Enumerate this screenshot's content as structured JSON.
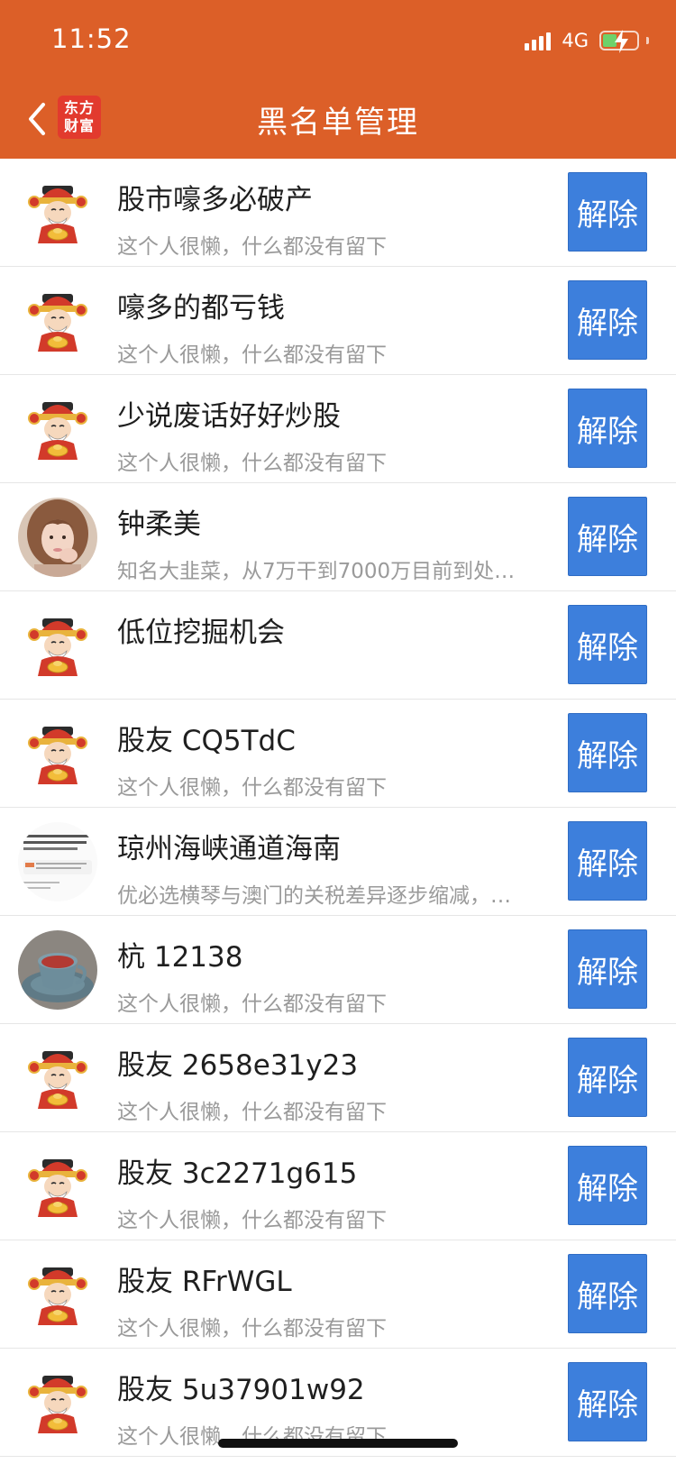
{
  "status_bar": {
    "time": "11:52",
    "network": "4G"
  },
  "header": {
    "title": "黑名单管理",
    "logo_line1": "东方",
    "logo_line2": "财富"
  },
  "colors": {
    "accent": "#dc5f28",
    "button": "#3d7fdc"
  },
  "items": [
    {
      "name": "股市嚎多必破产",
      "signature": "这个人很懒，什么都没有留下",
      "button": "解除",
      "avatar": "default-mascot"
    },
    {
      "name": "嚎多的都亏钱",
      "signature": "这个人很懒，什么都没有留下",
      "button": "解除",
      "avatar": "default-mascot"
    },
    {
      "name": "少说废话好好炒股",
      "signature": "这个人很懒，什么都没有留下",
      "button": "解除",
      "avatar": "default-mascot"
    },
    {
      "name": "钟柔美",
      "signature": "知名大韭菜，从7万干到7000万目前到处…",
      "button": "解除",
      "avatar": "photo-girl"
    },
    {
      "name": "低位挖掘机会",
      "signature": "",
      "button": "解除",
      "avatar": "default-mascot"
    },
    {
      "name": "股友 CQ5TdC",
      "signature": "这个人很懒，什么都没有留下",
      "button": "解除",
      "avatar": "default-mascot"
    },
    {
      "name": "琼州海峡通道海南",
      "signature": "优必选横琴与澳门的关税差异逐步缩减，…",
      "button": "解除",
      "avatar": "article-thumbnail"
    },
    {
      "name": "杭 12138",
      "signature": "这个人很懒，什么都没有留下",
      "button": "解除",
      "avatar": "photo-cup"
    },
    {
      "name": "股友 2658e31y23",
      "signature": "这个人很懒，什么都没有留下",
      "button": "解除",
      "avatar": "default-mascot"
    },
    {
      "name": "股友 3c2271g615",
      "signature": "这个人很懒，什么都没有留下",
      "button": "解除",
      "avatar": "default-mascot"
    },
    {
      "name": "股友 RFrWGL",
      "signature": "这个人很懒，什么都没有留下",
      "button": "解除",
      "avatar": "default-mascot"
    },
    {
      "name": "股友 5u37901w92",
      "signature": "这个人很懒，什么都没有留下",
      "button": "解除",
      "avatar": "default-mascot"
    }
  ]
}
